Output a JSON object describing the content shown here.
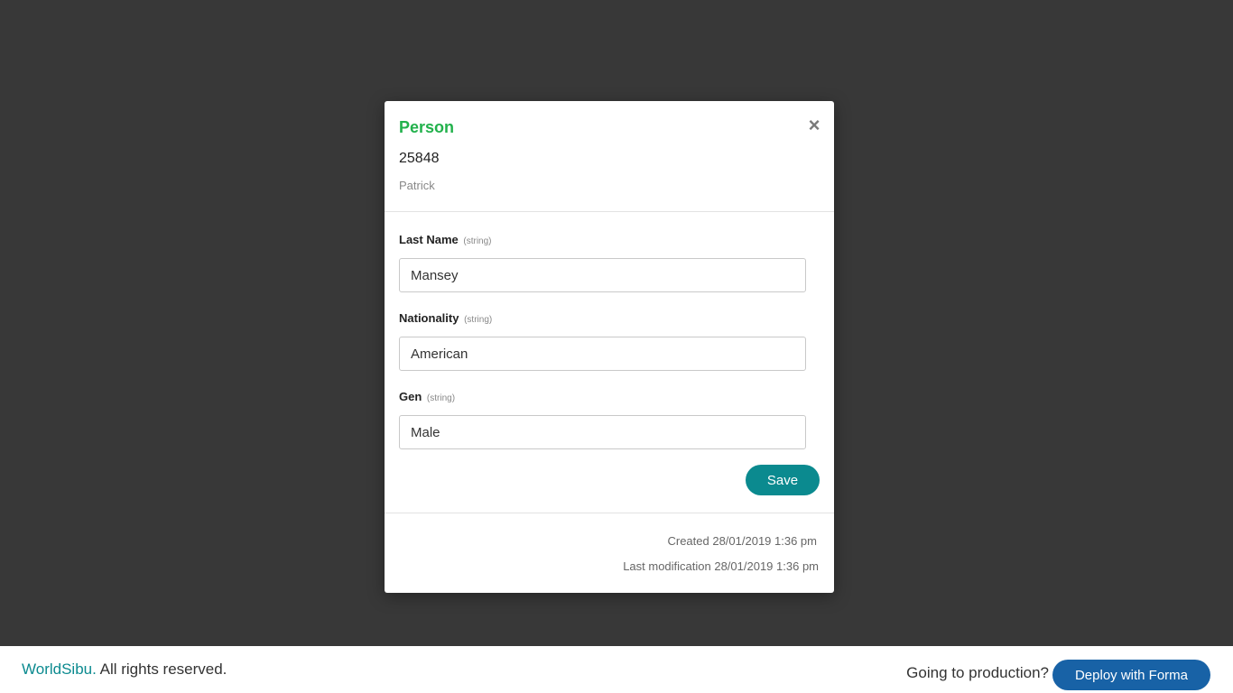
{
  "modal": {
    "title": "Person",
    "close_symbol": "×",
    "close_icon": "close-icon",
    "record_id": "25848",
    "record_subtitle": "Patrick",
    "fields": [
      {
        "label": "Last Name",
        "type": "(string)",
        "value": "Mansey"
      },
      {
        "label": "Nationality",
        "type": "(string)",
        "value": "American"
      },
      {
        "label": "Gen",
        "type": "(string)",
        "value": "Male"
      }
    ],
    "save_label": "Save",
    "created": "Created 28/01/2019 1:36 pm",
    "modified": "Last modification 28/01/2019 1:36 pm"
  },
  "footer": {
    "brand": "WorldSibu.",
    "rights": " All rights reserved.",
    "production_prompt": "Going to production?",
    "deploy_label": "Deploy with Forma"
  },
  "colors": {
    "title_green": "#22b14c",
    "teal": "#0b8a8f",
    "deploy_blue": "#1862a6",
    "overlay": "#383838"
  }
}
